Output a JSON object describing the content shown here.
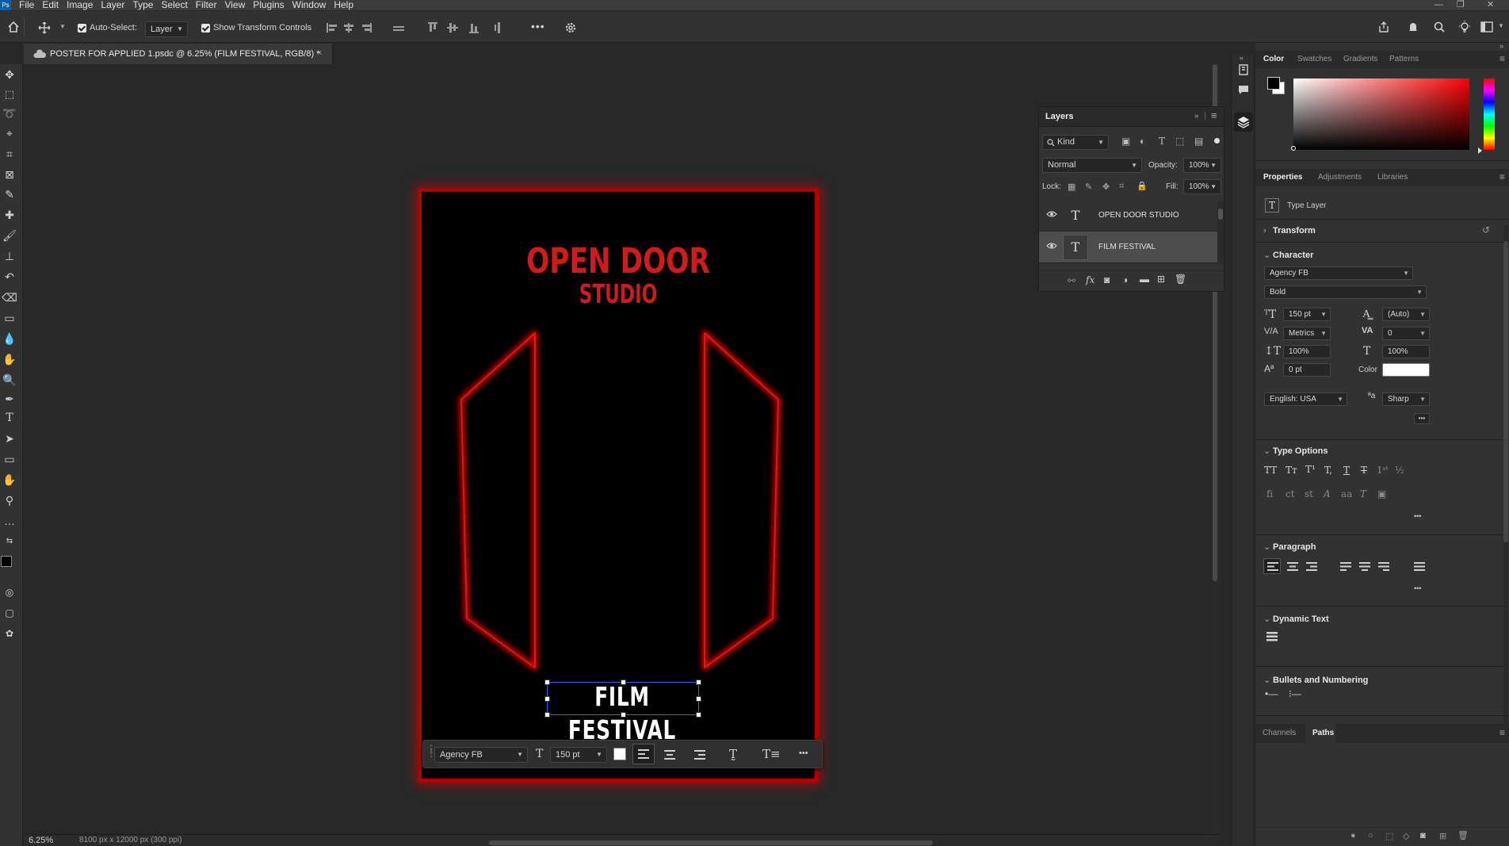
{
  "menu": [
    "File",
    "Edit",
    "Image",
    "Layer",
    "Type",
    "Select",
    "Filter",
    "View",
    "Plugins",
    "Window",
    "Help"
  ],
  "app": {
    "logo_text": "Ps",
    "win_min": "—",
    "win_restore": "❐",
    "win_close": "✕"
  },
  "options": {
    "auto_select_label": "Auto-Select:",
    "auto_select_value": "Layer",
    "transform_controls_label": "Show Transform Controls",
    "more_label": "•••"
  },
  "document": {
    "tab_title": "POSTER FOR APPLIED 1.psdc @ 6.25% (FILM FESTIVAL, RGB/8) *",
    "tab_close": "×",
    "zoom": "6.25%",
    "info": "8100 px x 12000 px (300 ppi)"
  },
  "poster": {
    "line1": "OPEN DOOR",
    "line2": "STUDIO",
    "bottom": "FILM FESTIVAL",
    "accent": "#d21a1a",
    "frame": "#b40000"
  },
  "taskbar": {
    "font": "Agency FB",
    "size": "150 pt",
    "more": "•••"
  },
  "layers": {
    "tab": "Layers",
    "filter_kind": "Kind",
    "blend_mode": "Normal",
    "opacity_label": "Opacity:",
    "opacity_value": "100%",
    "lock_label": "Lock:",
    "fill_label": "Fill:",
    "fill_value": "100%",
    "items": [
      {
        "name": "OPEN DOOR STUDIO",
        "selected": false
      },
      {
        "name": "FILM FESTIVAL",
        "selected": true
      }
    ]
  },
  "color_panel": {
    "tabs": [
      "Color",
      "Swatches",
      "Gradients",
      "Patterns"
    ],
    "hue": "#ff0000"
  },
  "properties": {
    "tabs": [
      "Properties",
      "Adjustments",
      "Libraries"
    ],
    "layer_type": "Type Layer",
    "transform_label": "Transform",
    "character_label": "Character",
    "font_family": "Agency FB",
    "font_style": "Bold",
    "font_size": "150 pt",
    "leading": "(Auto)",
    "kerning": "Metrics",
    "tracking": "0",
    "vertical_scale": "100%",
    "horizontal_scale": "100%",
    "baseline_shift": "0 pt",
    "color_label": "Color",
    "language": "English: USA",
    "antialias": "Sharp",
    "more": "•••",
    "type_options_label": "Type Options",
    "paragraph_label": "Paragraph",
    "dynamic_text_label": "Dynamic Text",
    "bullets_label": "Bullets and Numbering"
  },
  "bottom_panel": {
    "tabs": [
      "Channels",
      "Paths"
    ]
  }
}
